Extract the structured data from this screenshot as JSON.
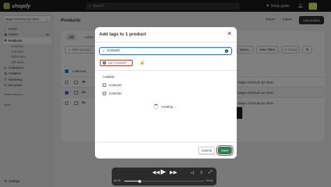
{
  "topbar": {
    "logo": "shopify",
    "search_placeholder": "Search",
    "setup_guide": "Setup guide"
  },
  "sidebar": {
    "store_name": "Magic Checkout QA Store",
    "items": [
      {
        "label": "Home",
        "icon": "home-icon"
      },
      {
        "label": "Orders",
        "icon": "orders-icon",
        "badge": "94"
      },
      {
        "label": "Products",
        "icon": "tag-icon",
        "active": true
      }
    ],
    "product_subitems": [
      "Inventory",
      "Transfers",
      "Collections",
      "Gift cards"
    ],
    "items2": [
      {
        "label": "Customers",
        "icon": "person-icon"
      },
      {
        "label": "Analytics",
        "icon": "chart-icon"
      },
      {
        "label": "Marketing",
        "icon": "target-icon"
      },
      {
        "label": "Discounts",
        "icon": "discount-icon"
      }
    ],
    "sales_channels": "Sales channels",
    "apps": "Apps",
    "settings": "Settings"
  },
  "main": {
    "title": "Products",
    "export": "Export",
    "import": "Import",
    "add_product": "Add product",
    "tabs": [
      "All",
      "Active"
    ],
    "filter_placeholder": "Filter product",
    "status": "Status",
    "more_filters": "More filters",
    "saved": "Saved",
    "selected_text": "1 selected",
    "rows": [
      {
        "name": "de",
        "store": "Magic Checkout QA Store",
        "checked": false
      },
      {
        "name": "sh",
        "store": "Magic Checkout QA Store",
        "checked": true
      },
      {
        "name": "Tu",
        "store": "Magic Checkout QA Store",
        "checked": false
      }
    ]
  },
  "modal": {
    "title": "Add tags to 1 product",
    "input_value": "COD500",
    "add_chip": "Add \"COD500\"",
    "available_label": "Available",
    "options": [
      "COD100",
      "COD200"
    ],
    "loading": "Loading ...",
    "cancel": "Cancel",
    "save": "Save"
  },
  "player": {
    "current_time": "00:15",
    "duration": "01:18",
    "progress": 0.19
  },
  "colors": {
    "accent": "#2c6ecb",
    "save_green": "#2e7d5b",
    "highlight_red": "#d72c0d",
    "topbar": "#1a1a1a"
  }
}
